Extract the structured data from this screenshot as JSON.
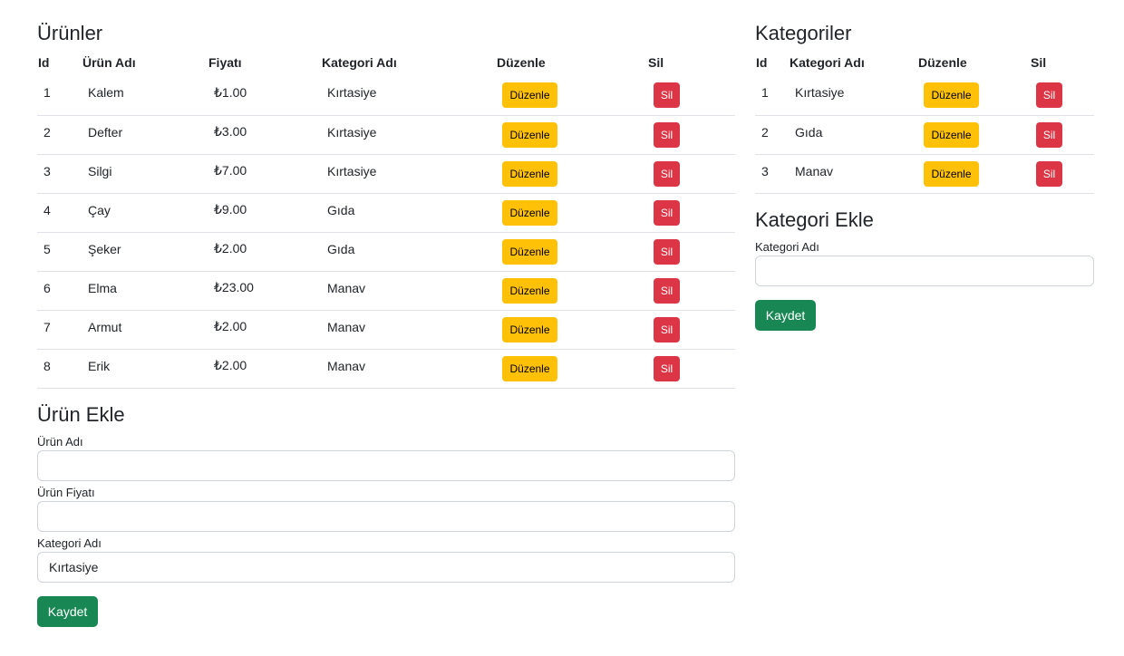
{
  "products": {
    "title": "Ürünler",
    "headers": [
      "Id",
      "Ürün Adı",
      "Fiyatı",
      "Kategori Adı",
      "Düzenle",
      "Sil"
    ],
    "rows": [
      {
        "id": "1",
        "name": "Kalem",
        "price": "₺1.00",
        "category": "Kırtasiye"
      },
      {
        "id": "2",
        "name": "Defter",
        "price": "₺3.00",
        "category": "Kırtasiye"
      },
      {
        "id": "3",
        "name": "Silgi",
        "price": "₺7.00",
        "category": "Kırtasiye"
      },
      {
        "id": "4",
        "name": "Çay",
        "price": "₺9.00",
        "category": "Gıda"
      },
      {
        "id": "5",
        "name": "Şeker",
        "price": "₺2.00",
        "category": "Gıda"
      },
      {
        "id": "6",
        "name": "Elma",
        "price": "₺23.00",
        "category": "Manav"
      },
      {
        "id": "7",
        "name": "Armut",
        "price": "₺2.00",
        "category": "Manav"
      },
      {
        "id": "8",
        "name": "Erik",
        "price": "₺2.00",
        "category": "Manav"
      }
    ],
    "edit_label": "Düzenle",
    "delete_label": "Sil"
  },
  "add_product": {
    "title": "Ürün Ekle",
    "name_label": "Ürün Adı",
    "name_value": "",
    "price_label": "Ürün Fiyatı",
    "price_value": "",
    "category_label": "Kategori Adı",
    "category_value": "Kırtasiye",
    "save_label": "Kaydet"
  },
  "categories": {
    "title": "Kategoriler",
    "headers": [
      "Id",
      "Kategori Adı",
      "Düzenle",
      "Sil"
    ],
    "rows": [
      {
        "id": "1",
        "name": "Kırtasiye"
      },
      {
        "id": "2",
        "name": "Gıda"
      },
      {
        "id": "3",
        "name": "Manav"
      }
    ],
    "edit_label": "Düzenle",
    "delete_label": "Sil"
  },
  "add_category": {
    "title": "Kategori Ekle",
    "name_label": "Kategori Adı",
    "name_value": "",
    "save_label": "Kaydet"
  },
  "colors": {
    "warning": "#ffc107",
    "danger": "#dc3545",
    "success": "#198754",
    "border": "#dee2e6"
  }
}
